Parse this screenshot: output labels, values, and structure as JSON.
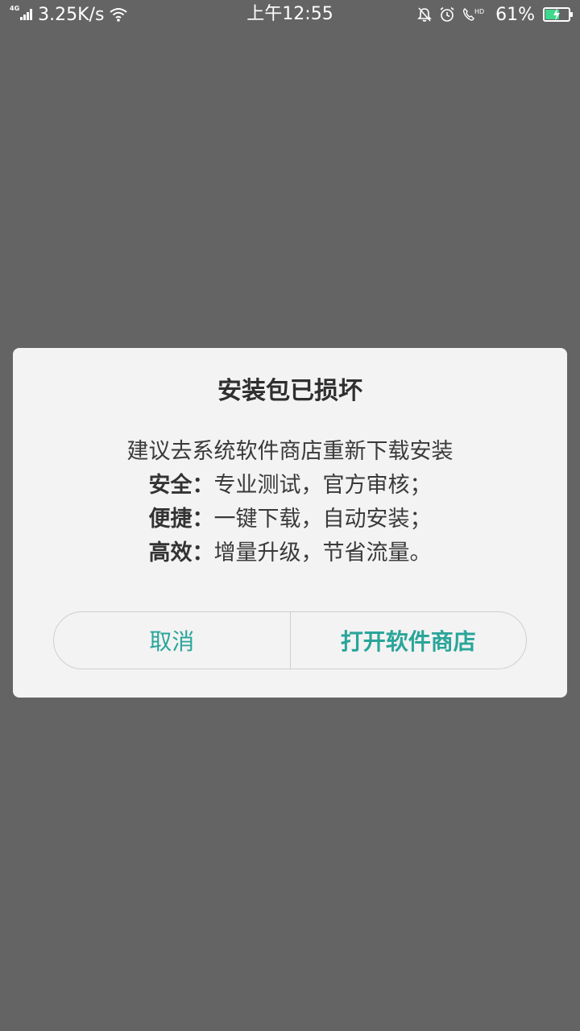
{
  "status_bar": {
    "network_type": "4G",
    "net_speed": "3.25K/s",
    "time": "上午12:55",
    "battery_percent": "61%",
    "battery_level": 0.61,
    "battery_color": "#3dd88c",
    "icons": [
      "signal-icon",
      "wifi-icon",
      "mute-icon",
      "alarm-icon",
      "hd-call-icon",
      "battery-icon"
    ]
  },
  "dialog": {
    "title": "安装包已损坏",
    "message": "建议去系统软件商店重新下载安装",
    "features": [
      {
        "label": "安全：",
        "text": "专业测试，官方审核；"
      },
      {
        "label": "便捷：",
        "text": "一键下载，自动安装；"
      },
      {
        "label": "高效：",
        "text": "增量升级，节省流量。"
      }
    ],
    "cancel_label": "取消",
    "open_store_label": "打开软件商店",
    "accent_color": "#2aa59a"
  }
}
